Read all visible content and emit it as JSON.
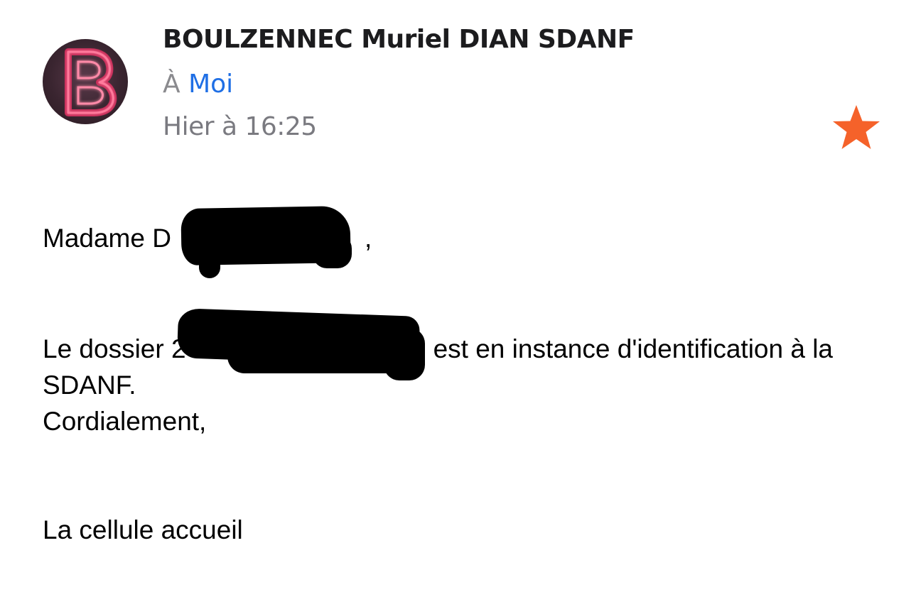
{
  "header": {
    "avatar_letter": "B",
    "avatar_neon_color": "#e8366a",
    "sender_name": "BOULZENNEC Muriel DIAN SDANF",
    "recipient_prefix": "À",
    "recipient_name": "Moi",
    "date_text": "Hier à 16:25",
    "star_icon": "star-filled",
    "star_color": "#f5622a",
    "link_color": "#1f6fe5"
  },
  "message": {
    "greeting_prefix": "Madame D",
    "greeting_suffix": ",",
    "dossier_prefix": "Le dossier 2",
    "dossier_suffix": "est en instance d'identification à la",
    "line_sdanf": "SDANF.",
    "closing": "Cordialement,",
    "signature": "La cellule accueil"
  }
}
